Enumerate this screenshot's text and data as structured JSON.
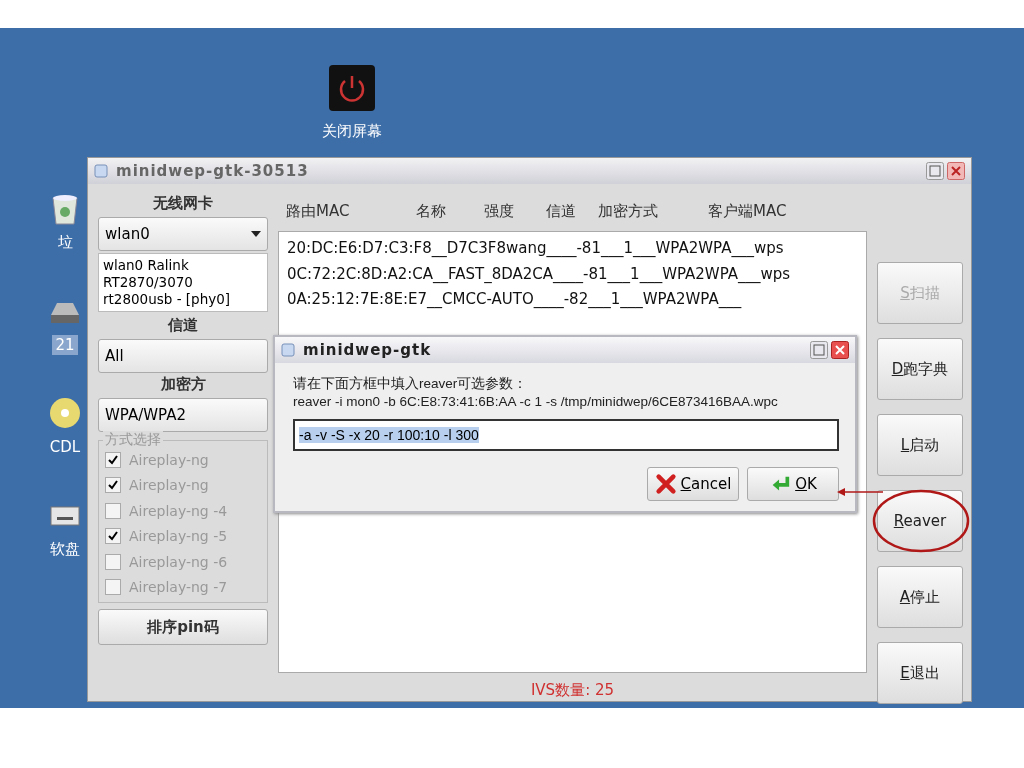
{
  "desktop": {
    "icons": [
      {
        "kind": "trash",
        "label": "垃",
        "selected": false
      },
      {
        "kind": "drive",
        "label": "21",
        "selected": true
      },
      {
        "kind": "cd",
        "label": "CDL",
        "selected": false
      },
      {
        "kind": "floppy",
        "label": "软盘",
        "selected": false
      }
    ],
    "power_icon": {
      "label": "关闭屏幕"
    }
  },
  "window": {
    "title": "minidwep-gtk-30513",
    "left": {
      "card_label": "无线网卡",
      "card_value": "wlan0",
      "card_info": "wlan0 Ralink RT2870/3070 rt2800usb - [phy0]",
      "channel_label": "信道",
      "channel_value": "All",
      "enc_label": "加密方",
      "enc_value": "WPA/WPA2",
      "methods_label": "方式选择",
      "methods": [
        {
          "label": "Aireplay-ng",
          "checked": true,
          "disabled": true
        },
        {
          "label": "Aireplay-ng",
          "checked": true,
          "disabled": true
        },
        {
          "label": "Aireplay-ng -4",
          "checked": false,
          "disabled": true
        },
        {
          "label": "Aireplay-ng -5",
          "checked": true,
          "disabled": true
        },
        {
          "label": "Aireplay-ng -6",
          "checked": false,
          "disabled": true
        },
        {
          "label": "Aireplay-ng -7",
          "checked": false,
          "disabled": true
        }
      ],
      "sort_button": "排序pin码"
    },
    "columns": [
      "路由MAC",
      "名称",
      "强度",
      "信道",
      "加密方式",
      "客户端MAC"
    ],
    "rows": [
      "20:DC:E6:D7:C3:F8__D7C3F8wang____-81___1___WPA2WPA___wps",
      "0C:72:2C:8D:A2:CA__FAST_8DA2CA____-81___1___WPA2WPA___wps",
      "0A:25:12:7E:8E:E7__CMCC-AUTO____-82___1___WPA2WPA___"
    ],
    "status": "IVS数量: 25",
    "buttons": [
      {
        "label": "S扫描",
        "disabled": true,
        "highlighted": false
      },
      {
        "label": "D跑字典",
        "disabled": false,
        "highlighted": false
      },
      {
        "label": "L启动",
        "disabled": false,
        "highlighted": false
      },
      {
        "label": "Reaver",
        "disabled": false,
        "highlighted": true
      },
      {
        "label": "A停止",
        "disabled": false,
        "highlighted": false
      },
      {
        "label": "E退出",
        "disabled": false,
        "highlighted": false
      }
    ]
  },
  "dialog": {
    "title": "minidwep-gtk",
    "prompt": "请在下面方框中填入reaver可选参数：",
    "command": "reaver -i mon0 -b 6C:E8:73:41:6B:AA -c 1 -s /tmp/minidwep/6CE873416BAA.wpc",
    "input": {
      "value": "-a -v -S -x 20 -r 100:10 -l 300",
      "selected": true
    },
    "buttons": [
      {
        "kind": "cancel",
        "label": "Cancel"
      },
      {
        "kind": "ok",
        "label": "OK"
      }
    ]
  }
}
